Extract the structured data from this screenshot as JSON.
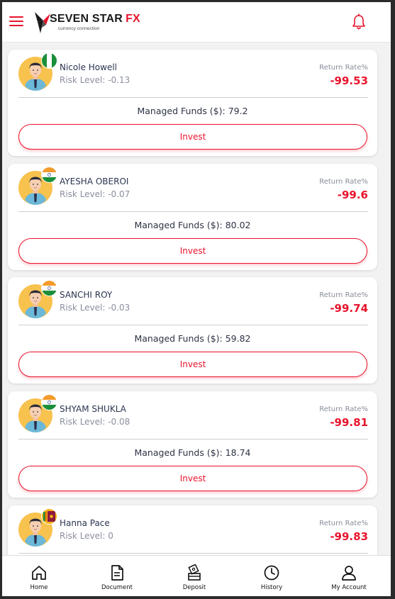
{
  "header": {
    "brand": "SEVEN STAR",
    "brand_accent": "FX",
    "tagline": "currency connection",
    "menu_icon": "hamburger-menu-icon",
    "notification_icon": "bell-icon"
  },
  "colors": {
    "accent": "#e8142c",
    "text": "#2c3550",
    "muted": "#8a8f9e"
  },
  "traders": [
    {
      "name": "Nicole Howell",
      "risk": "Risk Level: -0.13",
      "return_label": "Return Rate%",
      "return_value": "-99.53",
      "funds": "Managed Funds ($): 79.2",
      "invest_label": "Invest",
      "flag": "nigeria"
    },
    {
      "name": "AYESHA OBEROI",
      "risk": "Risk Level: -0.07",
      "return_label": "Return Rate%",
      "return_value": "-99.6",
      "funds": "Managed Funds ($): 80.02",
      "invest_label": "Invest",
      "flag": "india"
    },
    {
      "name": "SANCHI ROY",
      "risk": "Risk Level: -0.03",
      "return_label": "Return Rate%",
      "return_value": "-99.74",
      "funds": "Managed Funds ($): 59.82",
      "invest_label": "Invest",
      "flag": "india"
    },
    {
      "name": "SHYAM SHUKLA",
      "risk": "Risk Level: -0.08",
      "return_label": "Return Rate%",
      "return_value": "-99.81",
      "funds": "Managed Funds ($): 18.74",
      "invest_label": "Invest",
      "flag": "india"
    },
    {
      "name": "Hanna Pace",
      "risk": "Risk Level: 0",
      "return_label": "Return Rate%",
      "return_value": "-99.83",
      "funds": "",
      "invest_label": "",
      "flag": "sri-lanka"
    }
  ],
  "nav": [
    {
      "label": "Home",
      "icon": "home-icon"
    },
    {
      "label": "Document",
      "icon": "document-icon"
    },
    {
      "label": "Deposit",
      "icon": "deposit-icon"
    },
    {
      "label": "History",
      "icon": "history-icon"
    },
    {
      "label": "My Account",
      "icon": "account-icon"
    }
  ]
}
